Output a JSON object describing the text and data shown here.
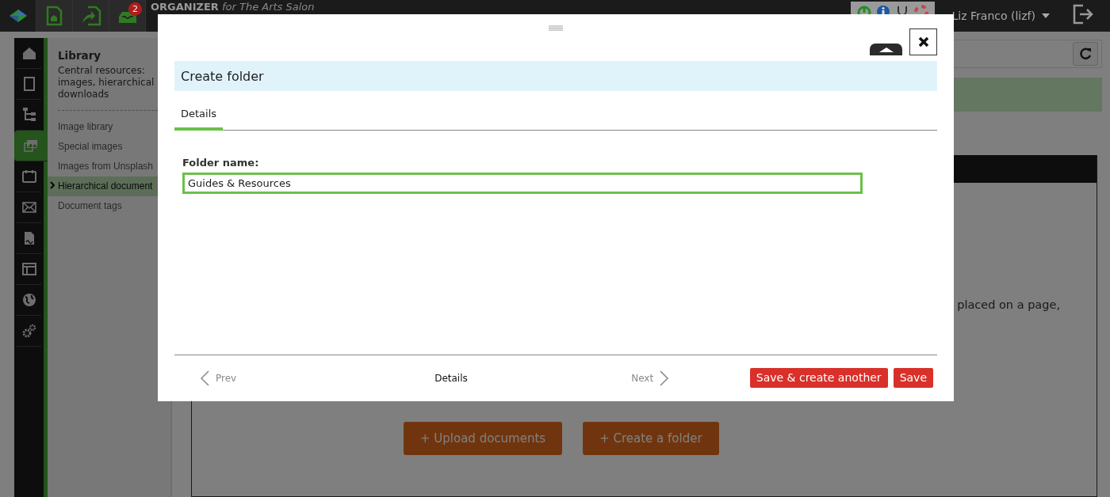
{
  "topbar": {
    "app_icons": [
      {
        "kind": "logo",
        "selected": false
      },
      {
        "kind": "site",
        "selected": false
      },
      {
        "kind": "import",
        "selected": false
      },
      {
        "kind": "inbox",
        "selected": false,
        "badge": "2"
      }
    ],
    "title": "**ORGANIZER** *for The Arts Salon*",
    "user": "Liz Franco (lizf)"
  },
  "nav_rail": [
    {
      "kind": "home",
      "selected": false
    },
    {
      "kind": "page",
      "selected": false
    },
    {
      "kind": "tree",
      "selected": false
    },
    {
      "kind": "images",
      "selected": true
    },
    {
      "kind": "calendar",
      "selected": false
    },
    {
      "kind": "mail",
      "selected": false
    },
    {
      "kind": "document",
      "selected": false
    },
    {
      "kind": "layout",
      "selected": false
    },
    {
      "kind": "globe",
      "selected": false
    },
    {
      "kind": "gears",
      "selected": false
    }
  ],
  "sidebar": {
    "title": "Library",
    "description": "Central resources: images, hierarchical downloads",
    "items": [
      {
        "label": "Image library",
        "selected": false
      },
      {
        "label": "Special images",
        "selected": false
      },
      {
        "label": "Images from Unsplash",
        "selected": false
      },
      {
        "label": "Hierarchical document",
        "selected": true
      },
      {
        "label": "Document tags",
        "selected": false
      }
    ]
  },
  "main": {
    "body_text": "placed on a page,",
    "buttons": [
      "+ Upload documents",
      "+ Create a folder"
    ]
  },
  "dialog": {
    "title": "Create folder",
    "tabs": [
      {
        "label": "Details",
        "selected": true
      }
    ],
    "field": {
      "label": "Folder name:",
      "value": "Guides & Resources"
    },
    "footer": {
      "prev": "Prev",
      "step": "Details",
      "next": "Next"
    },
    "buttons": [
      "Save & create another",
      "Save"
    ]
  }
}
